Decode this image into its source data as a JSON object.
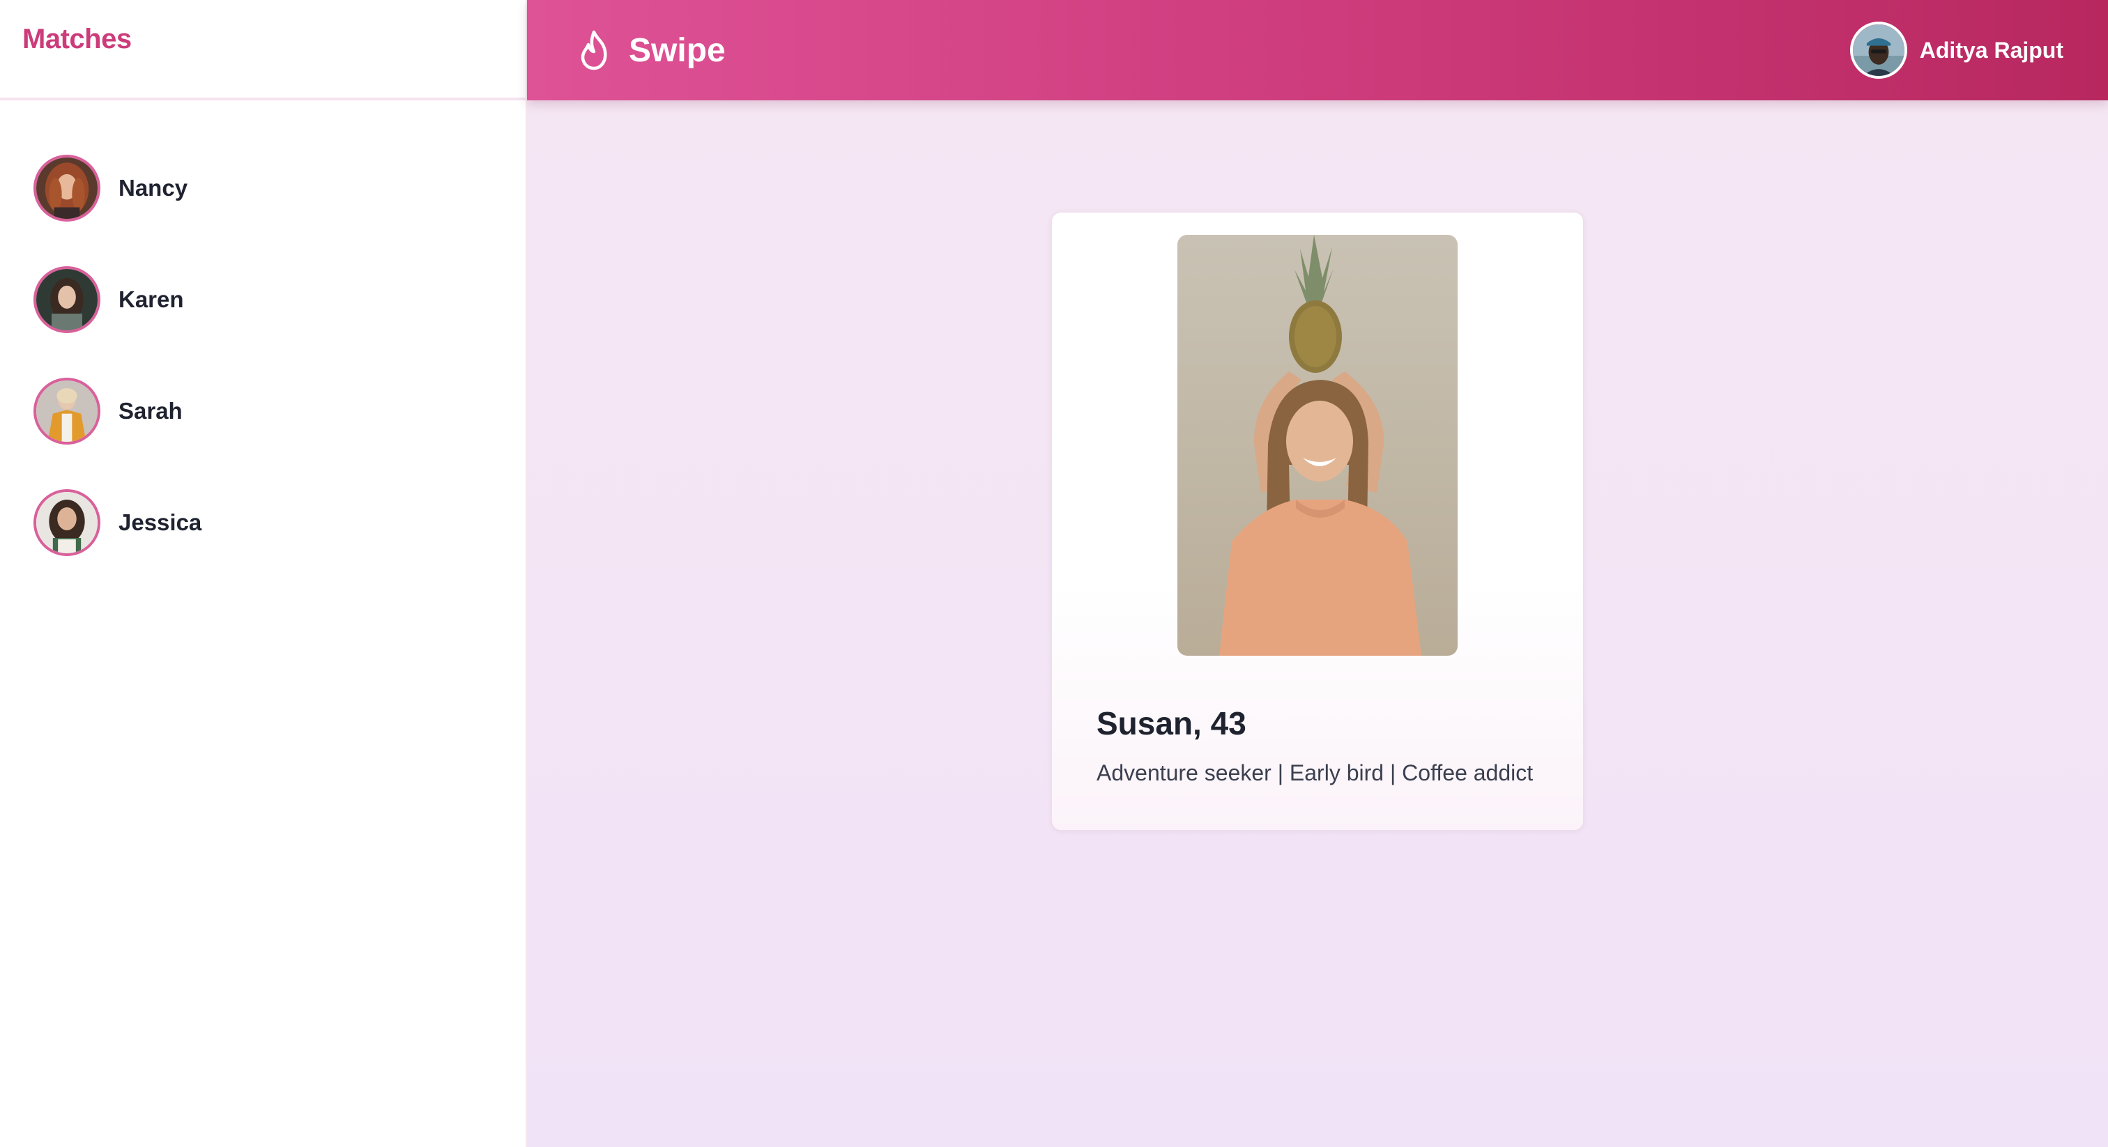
{
  "sidebar": {
    "title": "Matches",
    "matches": [
      {
        "name": "Nancy"
      },
      {
        "name": "Karen"
      },
      {
        "name": "Sarah"
      },
      {
        "name": "Jessica"
      }
    ]
  },
  "header": {
    "brand": "Swipe",
    "brand_icon": "flame-icon",
    "user_name": "Aditya Rajput"
  },
  "profile": {
    "name_age": "Susan, 43",
    "bio": "Adventure seeker | Early bird | Coffee addict"
  },
  "colors": {
    "accent": "#cc3c7a",
    "header_gradient_start": "#de5296",
    "header_gradient_end": "#b8285f",
    "page_background": "#f4e5f5"
  }
}
